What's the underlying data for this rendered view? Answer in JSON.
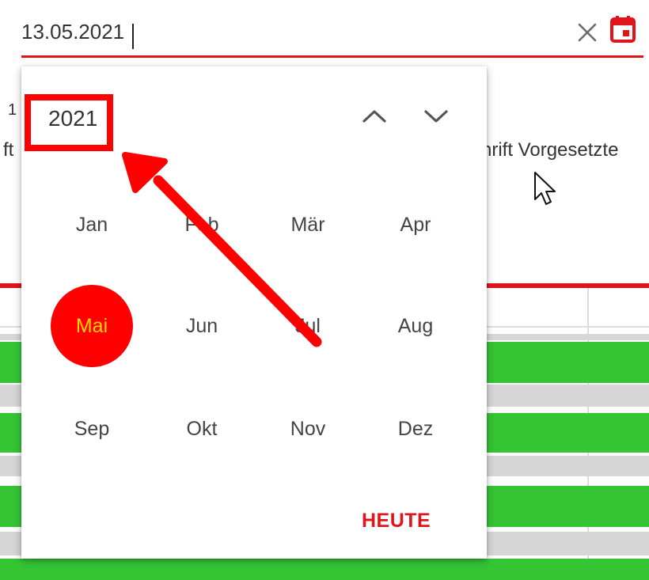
{
  "date_field": {
    "value": "13.05.2021"
  },
  "background": {
    "fragment_left_1": "1",
    "fragment_left_2": "ft",
    "column_header": "hrift Vorgesetzte"
  },
  "picker": {
    "year": "2021",
    "months": [
      "Jan",
      "Feb",
      "Mär",
      "Apr",
      "Mai",
      "Jun",
      "Jul",
      "Aug",
      "Sep",
      "Okt",
      "Nov",
      "Dez"
    ],
    "selected_month": "Mai",
    "today_label": "HEUTE"
  },
  "icons": {
    "clear": "close-icon",
    "calendar": "calendar-icon",
    "prev_year": "chevron-up-icon",
    "next_year": "chevron-down-icon",
    "cursor": "mouse-pointer-icon"
  },
  "colors": {
    "accent": "#e0141b",
    "selected_bg": "#ff0000",
    "selected_text": "#ffd400",
    "status_green": "#34c434",
    "annotation": "#ff0000"
  }
}
